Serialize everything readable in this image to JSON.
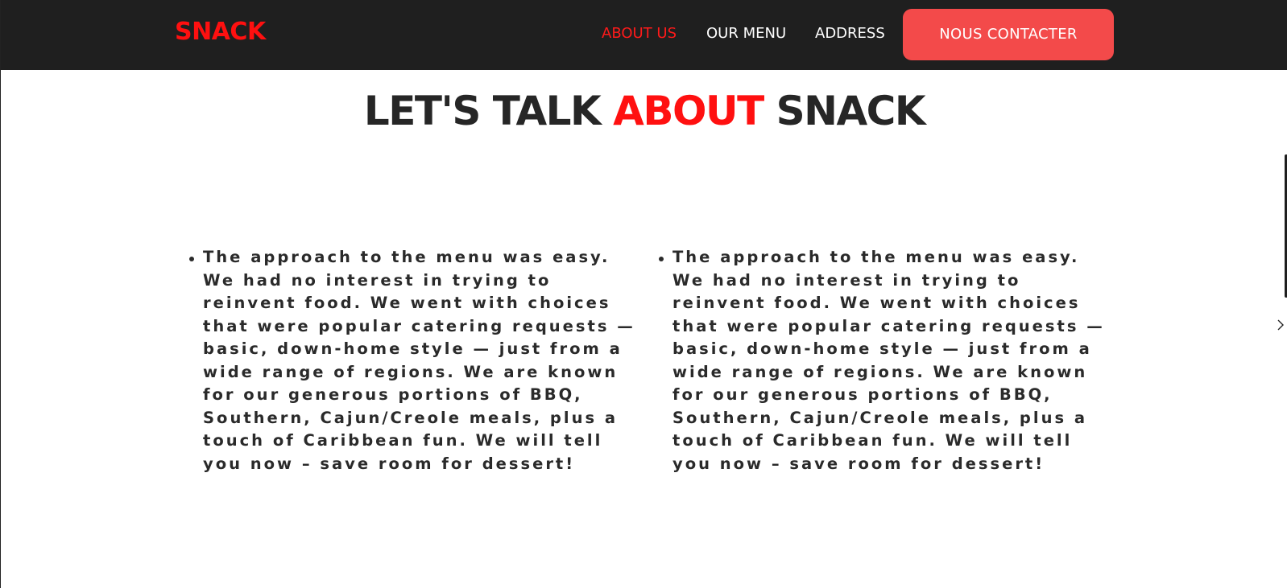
{
  "navbar": {
    "brand": "SNACK",
    "links": [
      {
        "label": "ABOUT US",
        "active": true
      },
      {
        "label": "OUR MENU",
        "active": false
      },
      {
        "label": "ADDRESS",
        "active": false
      }
    ],
    "cta_label": "NOUS CONTACTER"
  },
  "section": {
    "title_before": "LET'S TALK ",
    "title_highlight": "ABOUT",
    "title_after": " SNACK",
    "columns": [
      {
        "text": "The approach to the menu was easy. We had no interest in trying to reinvent food. We went with choices that were popular catering requests — basic, down-home style — just from a wide range of regions. We are known for our generous portions of BBQ, Southern, Cajun/Creole meals, plus a touch of Caribbean fun. We will tell you now – save room for dessert!"
      },
      {
        "text": "The approach to the menu was easy. We had no interest in trying to reinvent food. We went with choices that were popular catering requests — basic, down-home style — just from a wide range of regions. We are known for our generous portions of BBQ, Southern, Cajun/Creole meals, plus a touch of Caribbean fun. We will tell you now – save room for dessert!"
      }
    ]
  },
  "icons": {
    "next": "chevron-right-icon"
  },
  "colors": {
    "accent": "#ff1010",
    "navbar_bg": "#1f1f1f",
    "cta_bg": "#f34a4a",
    "text_dark": "#262626"
  }
}
